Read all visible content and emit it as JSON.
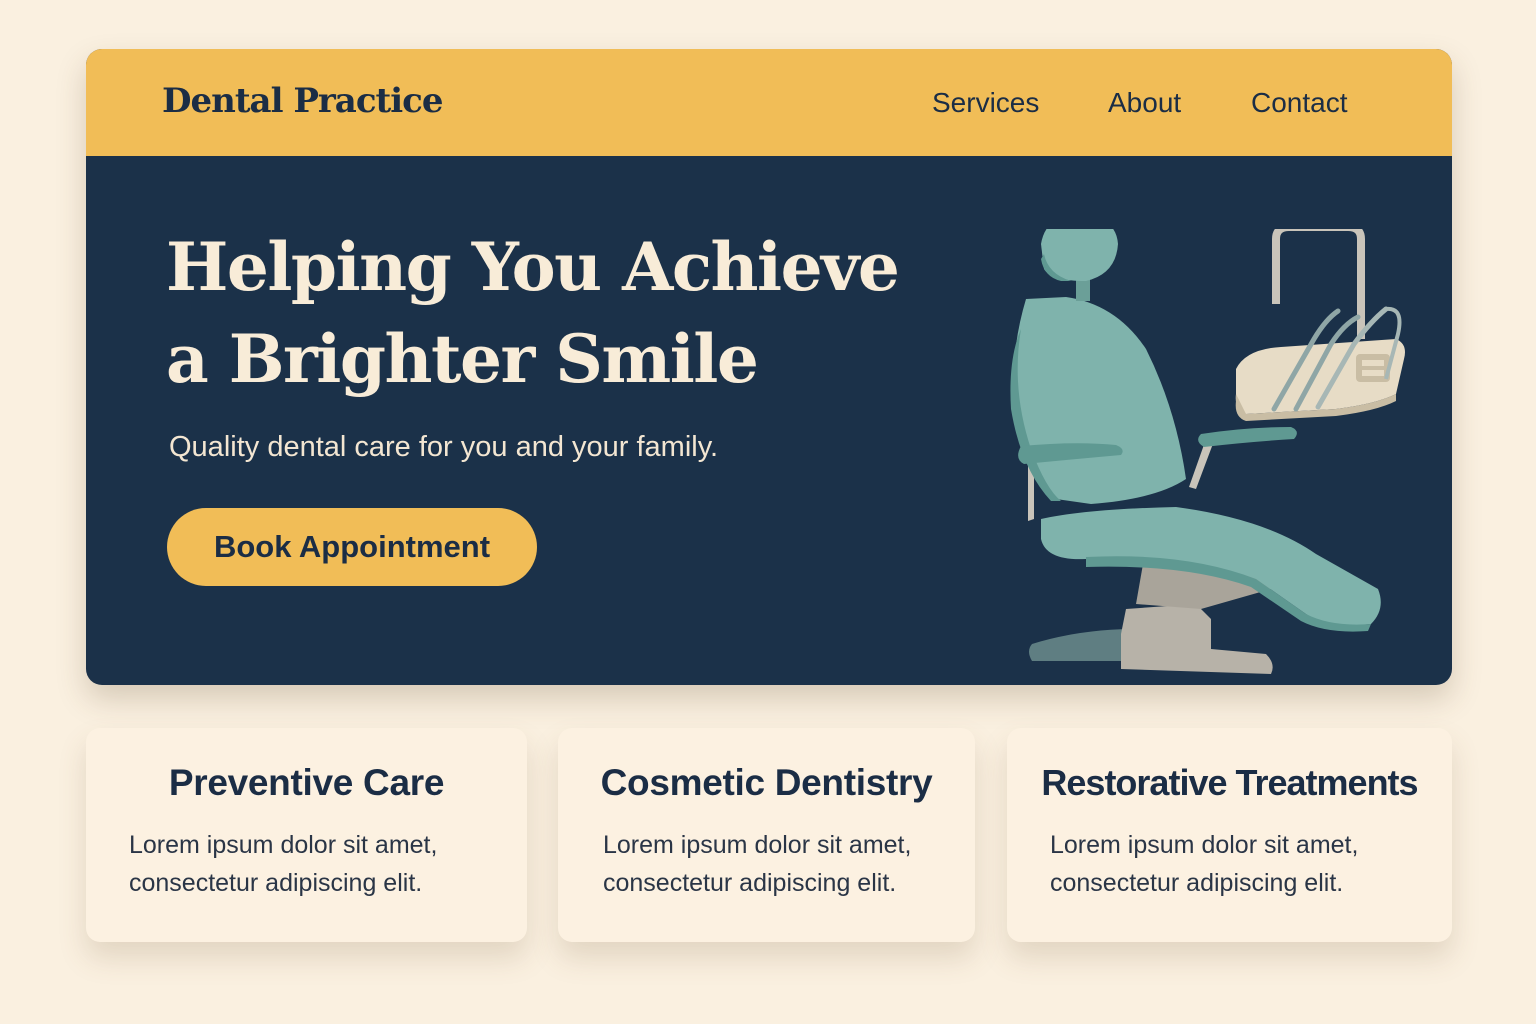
{
  "navbar": {
    "brand": "Dental Practice",
    "links": [
      {
        "label": "Services"
      },
      {
        "label": "About"
      },
      {
        "label": "Contact"
      }
    ]
  },
  "hero": {
    "title_line1": "Helping You Achieve",
    "title_line2": "a Brighter Smile",
    "subtitle": "Quality dental care for you and your family.",
    "cta_label": "Book Appointment",
    "illustration": "dental-chair-illustration"
  },
  "services": [
    {
      "title": "Preventive Care",
      "text_line1": "Lorem ipsum dolor sit amet,",
      "text_line2": "consectetur adipiscing elit."
    },
    {
      "title": "Cosmetic Dentistry",
      "text_line1": "Lorem ipsum dolor sit amet,",
      "text_line2": "consectetur adipiscing elit."
    },
    {
      "title": "Restorative Treatments",
      "text_line1": "Lorem ipsum dolor sit amet,",
      "text_line2": "consectetur adipiscing elit."
    }
  ],
  "colors": {
    "background": "#faf0e0",
    "accent": "#f1bd57",
    "hero_bg": "#1b3149",
    "text_dark": "#1b2d45",
    "text_light": "#f8ecd8",
    "chair_teal": "#7fb3ac",
    "chair_base": "#b7b2a8"
  }
}
